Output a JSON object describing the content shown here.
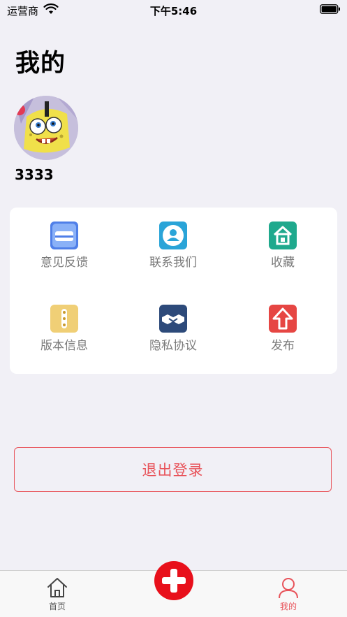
{
  "status_bar": {
    "carrier": "运营商",
    "time": "下午5:46"
  },
  "header": {
    "title": "我的"
  },
  "profile": {
    "username": "3333"
  },
  "menu": {
    "items": [
      {
        "label": "意见反馈",
        "icon": "feedback-icon",
        "color": "#4f7fe8"
      },
      {
        "label": "联系我们",
        "icon": "contact-icon",
        "color": "#2aa4d8"
      },
      {
        "label": "收藏",
        "icon": "favorites-icon",
        "color": "#1fa98d"
      },
      {
        "label": "版本信息",
        "icon": "version-icon",
        "color": "#f0cf76"
      },
      {
        "label": "隐私协议",
        "icon": "privacy-icon",
        "color": "#2d4a7a"
      },
      {
        "label": "发布",
        "icon": "publish-icon",
        "color": "#e64643"
      }
    ]
  },
  "logout": {
    "label": "退出登录"
  },
  "tab_bar": {
    "tabs": [
      {
        "label": "首页",
        "icon": "home-icon"
      },
      {
        "label": "我的",
        "icon": "user-icon",
        "active": true
      }
    ],
    "active_color": "#e8535a",
    "fab_icon": "plus-icon",
    "fab_color": "#e8101b"
  }
}
